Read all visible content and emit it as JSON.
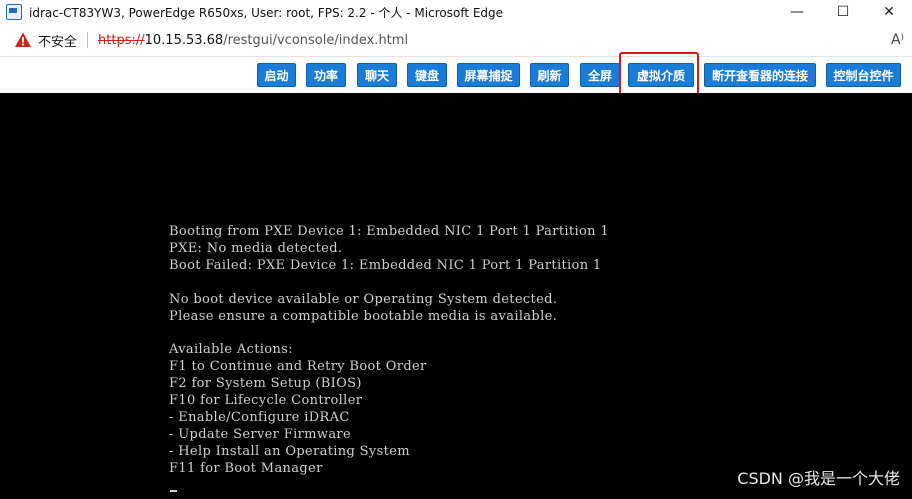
{
  "window": {
    "title": "idrac-CT83YW3, PowerEdge R650xs, User: root, FPS: 2.2 - 个人 - Microsoft Edge",
    "minimize": "—",
    "maximize": "☐",
    "close": "✕"
  },
  "address": {
    "security_label": "不安全",
    "url_scheme": "https://",
    "url_host": "10.15.53.68",
    "url_path": "/restgui/vconsole/index.html",
    "read_aloud": "A⁾"
  },
  "toolbar": {
    "buttons": [
      "启动",
      "功率",
      "聊天",
      "键盘",
      "屏幕捕捉",
      "刷新",
      "全屏",
      "虚拟介质",
      "断开查看器的连接",
      "控制台控件"
    ],
    "accent_color": "#1a7cd6",
    "highlight_color": "#e01515"
  },
  "console": {
    "lines": [
      "Booting from PXE Device 1: Embedded NIC 1 Port 1 Partition 1",
      "PXE: No media detected.",
      "Boot Failed: PXE Device 1: Embedded NIC 1 Port 1 Partition 1",
      "",
      "No boot device available or Operating System detected.",
      "Please ensure a compatible bootable media is available.",
      "",
      "Available Actions:",
      "F1 to Continue and Retry Boot Order",
      "F2 for System Setup (BIOS)",
      "F10 for Lifecycle Controller",
      "- Enable/Configure iDRAC",
      "- Update Server Firmware",
      "- Help Install an Operating System",
      "F11 for Boot Manager"
    ]
  },
  "watermark": "CSDN @我是一个大佬"
}
